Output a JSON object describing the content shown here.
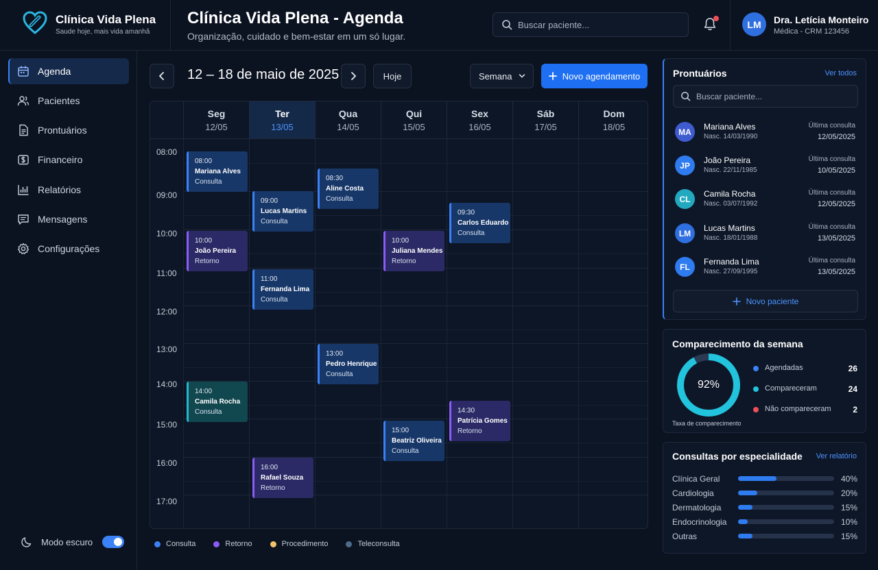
{
  "brand": {
    "name": "Clínica Vida Plena",
    "slogan": "Saude hoje, mais vida amanhã"
  },
  "header": {
    "title": "Clínica Vida Plena - Agenda",
    "subtitle": "Organização, cuidado e bem-estar em um só lugar.",
    "search_placeholder": "Buscar paciente...",
    "notifications_icon": "bell-icon",
    "user": {
      "initials": "LM",
      "name": "Dra. Letícia Monteiro",
      "role": "Médica - CRM 123456"
    }
  },
  "sidebar": {
    "items": [
      {
        "label": "Agenda",
        "icon": "calendar-icon",
        "active": true
      },
      {
        "label": "Pacientes",
        "icon": "users-icon"
      },
      {
        "label": "Prontuários",
        "icon": "file-icon"
      },
      {
        "label": "Financeiro",
        "icon": "dollar-icon"
      },
      {
        "label": "Relatórios",
        "icon": "bar-chart-icon"
      },
      {
        "label": "Mensagens",
        "icon": "message-icon"
      },
      {
        "label": "Configurações",
        "icon": "gear-icon"
      }
    ],
    "dark_mode_label": "Modo escuro",
    "dark_mode_on": true
  },
  "toolbar": {
    "range": "12 – 18 de maio de 2025",
    "today": "Hoje",
    "view": "Semana",
    "new_appointment": "Novo agendamento"
  },
  "calendar": {
    "days": [
      {
        "name": "Seg",
        "date": "12/05"
      },
      {
        "name": "Ter",
        "date": "13/05",
        "today": true
      },
      {
        "name": "Qua",
        "date": "14/05"
      },
      {
        "name": "Qui",
        "date": "15/05"
      },
      {
        "name": "Sex",
        "date": "16/05"
      },
      {
        "name": "Sáb",
        "date": "17/05"
      },
      {
        "name": "Dom",
        "date": "18/05"
      }
    ],
    "hours": [
      "08:00",
      "09:00",
      "10:00",
      "11:00",
      "12:00",
      "13:00",
      "14:00",
      "15:00",
      "16:00",
      "17:00"
    ],
    "events": [
      {
        "time": "08:00",
        "patient": "Mariana Alves",
        "type": "Consulta"
      },
      {
        "time": "10:00",
        "patient": "João Pereira",
        "type": "Retorno"
      },
      {
        "time": "14:00",
        "patient": "Camila Rocha",
        "type": "Consulta"
      },
      {
        "time": "09:00",
        "patient": "Lucas Martins",
        "type": "Consulta"
      },
      {
        "time": "11:00",
        "patient": "Fernanda Lima",
        "type": "Consulta"
      },
      {
        "time": "16:00",
        "patient": "Rafael Souza",
        "type": "Retorno"
      },
      {
        "time": "08:30",
        "patient": "Aline Costa",
        "type": "Consulta"
      },
      {
        "time": "13:00",
        "patient": "Pedro Henrique",
        "type": "Consulta"
      },
      {
        "time": "10:00",
        "patient": "Juliana Mendes",
        "type": "Retorno"
      },
      {
        "time": "15:00",
        "patient": "Beatriz Oliveira",
        "type": "Consulta"
      },
      {
        "time": "09:30",
        "patient": "Carlos Eduardo",
        "type": "Consulta"
      },
      {
        "time": "14:30",
        "patient": "Patrícia Gomes",
        "type": "Retorno"
      }
    ]
  },
  "legend": [
    {
      "label": "Consulta",
      "color": "#3b82f6"
    },
    {
      "label": "Retorno",
      "color": "#8b5cf6"
    },
    {
      "label": "Procedimento",
      "color": "#f0c36a"
    },
    {
      "label": "Teleconsulta",
      "color": "#4f6b8a"
    }
  ],
  "records": {
    "title": "Prontuários",
    "view_all": "Ver todos",
    "search_placeholder": "Buscar paciente...",
    "patients": [
      {
        "initials": "MA",
        "name": "Mariana Alves",
        "birth": "Nasc. 14/03/1990",
        "last_label": "Última consulta",
        "last_date": "12/05/2025",
        "color": "#3f5bd0"
      },
      {
        "initials": "JP",
        "name": "João Pereira",
        "birth": "Nasc. 22/11/1985",
        "last_label": "Última consulta",
        "last_date": "10/05/2025",
        "color": "#2f7bf0"
      },
      {
        "initials": "CL",
        "name": "Camila Rocha",
        "birth": "Nasc. 03/07/1992",
        "last_label": "Última consulta",
        "last_date": "12/05/2025",
        "color": "#22a9c0"
      },
      {
        "initials": "LM",
        "name": "Lucas Martins",
        "birth": "Nasc. 18/01/1988",
        "last_label": "Última consulta",
        "last_date": "13/05/2025",
        "color": "#2f6fe0"
      },
      {
        "initials": "FL",
        "name": "Fernanda Lima",
        "birth": "Nasc. 27/09/1995",
        "last_label": "Última consulta",
        "last_date": "13/05/2025",
        "color": "#2f7bf0"
      }
    ],
    "new_patient": "Novo paciente"
  },
  "attendance": {
    "title": "Comparecimento da semana",
    "percent": "92%",
    "rate_value": 0.92,
    "rate_label": "Taxa de comparecimento",
    "stats": [
      {
        "label": "Agendadas",
        "value": "26",
        "color": "#3b82f6"
      },
      {
        "label": "Compareceram",
        "value": "24",
        "color": "#22c3dd"
      },
      {
        "label": "Não compareceram",
        "value": "2",
        "color": "#ef4e5a"
      }
    ]
  },
  "specialties": {
    "title": "Consultas por especialidade",
    "link": "Ver relatório",
    "items": [
      {
        "name": "Clínica Geral",
        "percent": "40%",
        "value": 0.4
      },
      {
        "name": "Cardiologia",
        "percent": "20%",
        "value": 0.2
      },
      {
        "name": "Dermatologia",
        "percent": "15%",
        "value": 0.15
      },
      {
        "name": "Endocrinologia",
        "percent": "10%",
        "value": 0.1
      },
      {
        "name": "Outras",
        "percent": "15%",
        "value": 0.15
      }
    ]
  }
}
